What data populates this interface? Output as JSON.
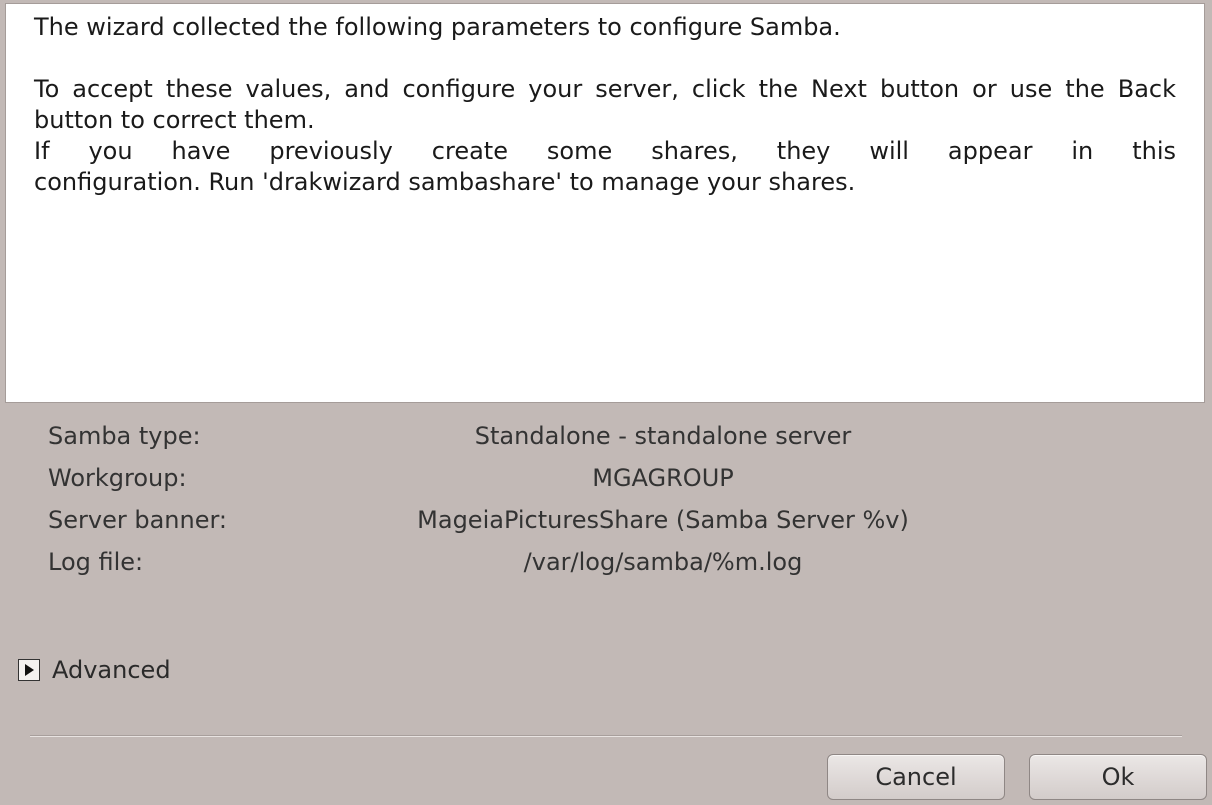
{
  "description": {
    "intro": "The wizard collected the following parameters to configure Samba.",
    "accept": "To accept these values, and configure your server, click the Next button or use the Back button to correct them.",
    "shares_line": "If you have previously create some shares, they will appear in this",
    "shares_tail": "configuration. Run 'drakwizard sambashare' to manage your shares."
  },
  "params": [
    {
      "label": "Samba type:",
      "value": "Standalone - standalone server"
    },
    {
      "label": "Workgroup:",
      "value": "MGAGROUP"
    },
    {
      "label": "Server banner:",
      "value": "MageiaPicturesShare (Samba Server %v)"
    },
    {
      "label": "Log file:",
      "value": "/var/log/samba/%m.log"
    }
  ],
  "advanced": {
    "label": "Advanced",
    "icon": "expander-right-icon"
  },
  "buttons": {
    "cancel": "Cancel",
    "ok": "Ok"
  }
}
